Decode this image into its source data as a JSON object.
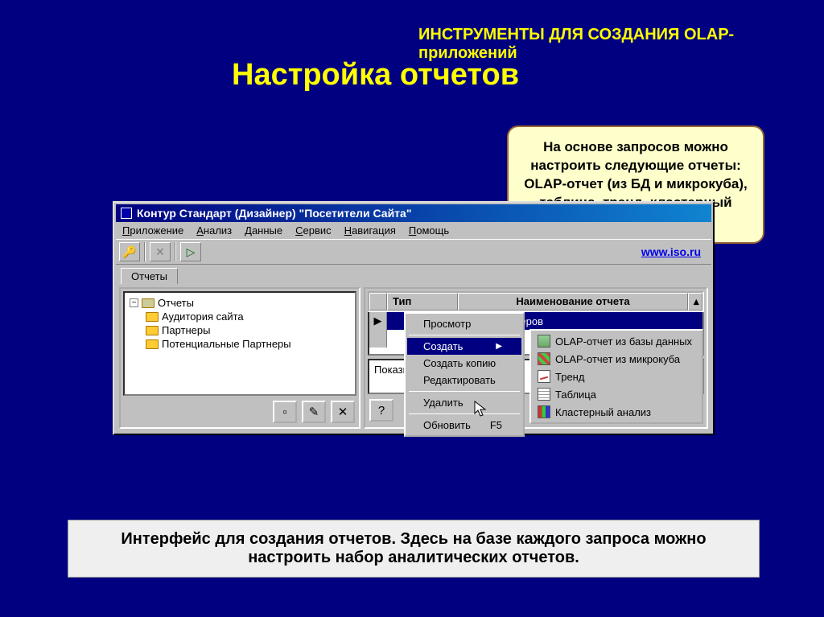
{
  "slide": {
    "subtitle": "ИНСТРУМЕНТЫ ДЛЯ СОЗДАНИЯ OLAP-приложений",
    "title": "Настройка отчетов"
  },
  "bubble": {
    "text": "На основе запросов можно настроить следующие отчеты: OLAP-отчет (из БД и микрокуба), таблица, тренд, кластерный анализ"
  },
  "window": {
    "title": "Контур Стандарт (Дизайнер) \"Посетители Сайта\"",
    "menu": [
      "Приложение",
      "Анализ",
      "Данные",
      "Сервис",
      "Навигация",
      "Помощь"
    ],
    "link": "www.iso.ru",
    "tab": "Отчеты",
    "tree": {
      "root": "Отчеты",
      "children": [
        "Аудитория сайта",
        "Партнеры",
        "Потенциальные Партнеры"
      ]
    },
    "grid": {
      "col_type": "Тип",
      "col_name": "Наименование отчета",
      "row1_name": "йта и Партнеров"
    },
    "desc": "Показывает и\nматериалам д"
  },
  "ctx": {
    "view": "Просмотр",
    "create": "Создать",
    "copy": "Создать копию",
    "edit": "Редактировать",
    "delete": "Удалить",
    "refresh": "Обновить",
    "refresh_key": "F5"
  },
  "submenu": {
    "olap_db": "OLAP-отчет из базы данных",
    "olap_mc": "OLAP-отчет из микрокуба",
    "trend": "Тренд",
    "table": "Таблица",
    "cluster": "Кластерный анализ"
  },
  "caption": "Интерфейс для создания отчетов. Здесь на базе каждого запроса можно настроить набор аналитических отчетов."
}
